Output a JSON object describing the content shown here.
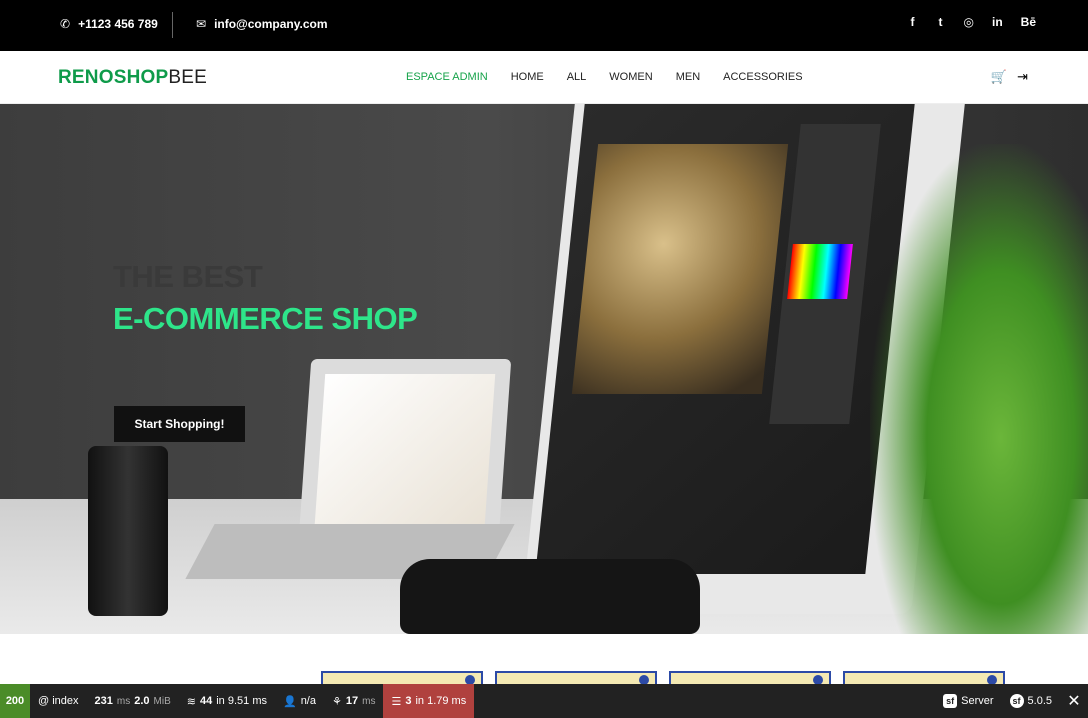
{
  "topbar": {
    "phone": "+1123 456 789",
    "email": "info@company.com",
    "social": [
      "f",
      "t",
      "◎",
      "in",
      "Bē"
    ]
  },
  "nav": {
    "logo_part1": "RENOSHOP",
    "logo_part2": "BEE",
    "menu": [
      "ESPACE ADMIN",
      "HOME",
      "ALL",
      "WOMEN",
      "MEN",
      "ACCESSORIES"
    ]
  },
  "hero": {
    "title_line1": "THE BEST",
    "title_line2": "E-COMMERCE SHOP",
    "button": "Start Shopping!"
  },
  "debugbar": {
    "status": "200",
    "route": "@ index",
    "time": "231",
    "time_unit": "ms",
    "memory": "2.0",
    "memory_unit": "MiB",
    "cache": "44",
    "cache_detail": "in 9.51 ms",
    "user": "n/a",
    "twig": "17",
    "twig_unit": "ms",
    "db": "3",
    "db_detail": "in 1.79 ms",
    "server": "Server",
    "version": "5.0.5"
  }
}
